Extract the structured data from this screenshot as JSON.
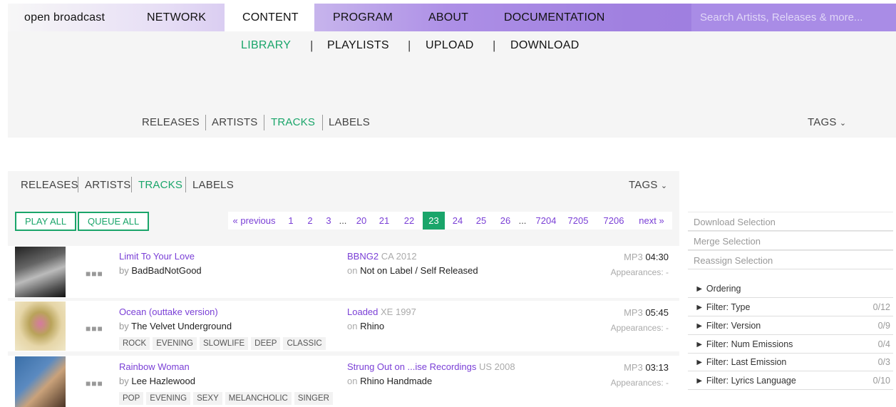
{
  "nav": {
    "brand": "open broadcast",
    "items": [
      "NETWORK",
      "CONTENT",
      "PROGRAM",
      "ABOUT",
      "DOCUMENTATION"
    ],
    "search_placeholder": "Search Artists, Releases & more..."
  },
  "subnav": {
    "items": [
      "LIBRARY",
      "PLAYLISTS",
      "UPLOAD",
      "DOWNLOAD"
    ]
  },
  "tabs": {
    "items": [
      "RELEASES",
      "ARTISTS",
      "TRACKS",
      "LABELS"
    ],
    "tags": "TAGS"
  },
  "actions": {
    "play_all": "PLAY ALL",
    "queue_all": "QUEUE ALL"
  },
  "pagination": {
    "previous": "« previous",
    "next": "next »",
    "pages": [
      "1",
      "2",
      "3",
      "...",
      "20",
      "21",
      "22",
      "23",
      "24",
      "25",
      "26",
      "...",
      "7204",
      "7205",
      "7206"
    ],
    "current": "23"
  },
  "tracks": [
    {
      "title": "Limit To Your Love",
      "artist": "BadBadNotGood",
      "release": "BBNG2",
      "release_meta": "CA 2012",
      "label": "Not on Label / Self Released",
      "format": "MP3",
      "duration": "04:30",
      "appearances": "Appearances: -",
      "tags": []
    },
    {
      "title": "Ocean (outtake version)",
      "artist": "The Velvet Underground",
      "release": "Loaded",
      "release_meta": "XE 1997",
      "label": "Rhino",
      "format": "MP3",
      "duration": "05:45",
      "appearances": "Appearances: -",
      "tags": [
        "ROCK",
        "EVENING",
        "SLOWLIFE",
        "DEEP",
        "CLASSIC"
      ]
    },
    {
      "title": "Rainbow Woman",
      "artist": "Lee Hazlewood",
      "release": "Strung Out on ...ise Recordings",
      "release_meta": "US 2008",
      "label": "Rhino Handmade",
      "format": "MP3",
      "duration": "03:13",
      "appearances": "Appearances: -",
      "tags": [
        "POP",
        "EVENING",
        "SEXY",
        "MELANCHOLIC",
        "SINGER"
      ]
    }
  ],
  "labels": {
    "by": "by",
    "on": "on",
    "more": "■■■"
  },
  "sidebar": {
    "actions": [
      "Download Selection",
      "Merge Selection",
      "Reassign Selection"
    ],
    "ordering": "► Ordering",
    "filters": [
      {
        "label": "► Filter: Type",
        "count": "0/12"
      },
      {
        "label": "► Filter: Version",
        "count": "0/9"
      },
      {
        "label": "► Filter: Num Emissions",
        "count": "0/4"
      },
      {
        "label": "► Filter: Last Emission",
        "count": "0/3"
      },
      {
        "label": "► Filter: Lyrics Language",
        "count": "0/10"
      }
    ]
  },
  "colors": {
    "accent": "#1aa56a",
    "link": "#7a3fd6",
    "nav": "#a080e0"
  }
}
